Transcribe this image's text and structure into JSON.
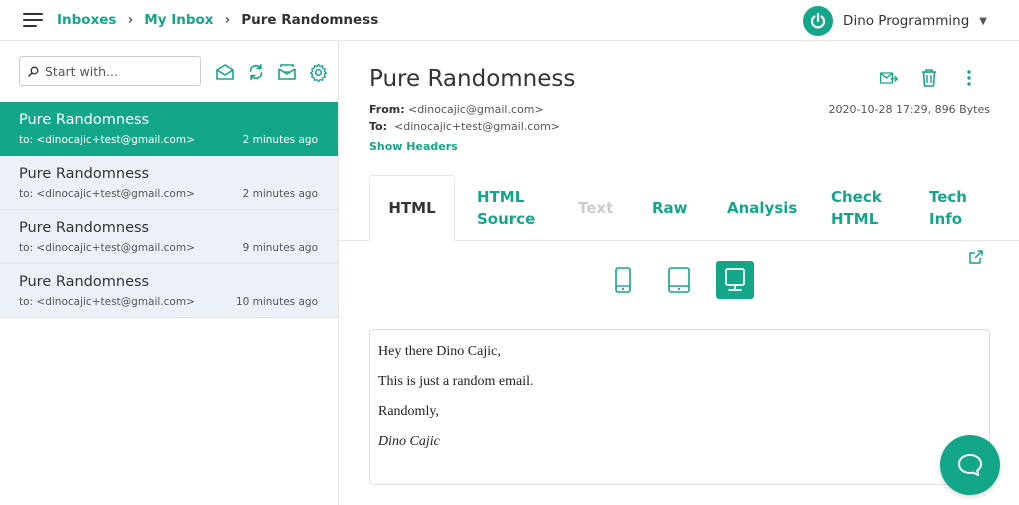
{
  "breadcrumb": {
    "inboxes": "Inboxes",
    "my_inbox": "My Inbox",
    "current": "Pure Randomness"
  },
  "account": {
    "name": "Dino Programming",
    "logo_icon": "power-icon"
  },
  "search": {
    "placeholder": "Start with..."
  },
  "toolbar_icons": [
    "compose-icon",
    "refresh-icon",
    "forward-icon",
    "settings-icon"
  ],
  "messages": [
    {
      "subject": "Pure Randomness",
      "to": "to: <dinocajic+test@gmail.com>",
      "time": "2 minutes ago",
      "active": true
    },
    {
      "subject": "Pure Randomness",
      "to": "to: <dinocajic+test@gmail.com>",
      "time": "2 minutes ago",
      "active": false
    },
    {
      "subject": "Pure Randomness",
      "to": "to: <dinocajic+test@gmail.com>",
      "time": "9 minutes ago",
      "active": false
    },
    {
      "subject": "Pure Randomness",
      "to": "to: <dinocajic+test@gmail.com>",
      "time": "10 minutes ago",
      "active": false
    }
  ],
  "email": {
    "subject": "Pure Randomness",
    "from_label": "From:",
    "from_value": "<dinocajic@gmail.com>",
    "to_label": "To:",
    "to_value": "<dinocajic+test@gmail.com>",
    "date_size": "2020-10-28 17:29, 896 Bytes",
    "show_headers": "Show Headers"
  },
  "tabs": {
    "html": "HTML",
    "html_source_1": "HTML",
    "html_source_2": "Source",
    "text": "Text",
    "raw": "Raw",
    "analysis": "Analysis",
    "check_html_1": "Check",
    "check_html_2": "HTML",
    "tech_info_1": "Tech",
    "tech_info_2": "Info"
  },
  "preview": {
    "line1": "Hey there Dino Cajic,",
    "line2": "This is just a random email.",
    "line3": "Randomly,",
    "signature": "Dino Cajic"
  },
  "colors": {
    "accent": "#13a688",
    "row_bg": "#ecf1f8"
  }
}
